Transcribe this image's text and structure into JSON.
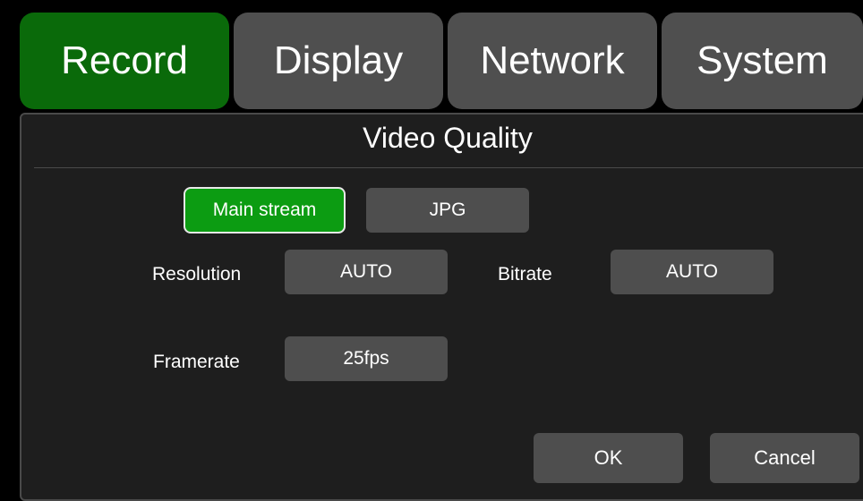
{
  "tabs": [
    {
      "label": "Record",
      "active": true
    },
    {
      "label": "Display",
      "active": false
    },
    {
      "label": "Network",
      "active": false
    },
    {
      "label": "System",
      "active": false
    }
  ],
  "panel": {
    "title": "Video Quality",
    "stream_options": [
      {
        "label": "Main stream",
        "selected": true
      },
      {
        "label": "JPG",
        "selected": false
      }
    ],
    "resolution": {
      "label": "Resolution",
      "value": "AUTO"
    },
    "bitrate": {
      "label": "Bitrate",
      "value": "AUTO"
    },
    "framerate": {
      "label": "Framerate",
      "value": "25fps"
    }
  },
  "actions": {
    "ok": "OK",
    "cancel": "Cancel"
  },
  "colors": {
    "active_tab": "#0a6a0a",
    "selected_option": "#0c9c12",
    "button": "#4e4e4e",
    "panel": "#1e1e1e"
  }
}
